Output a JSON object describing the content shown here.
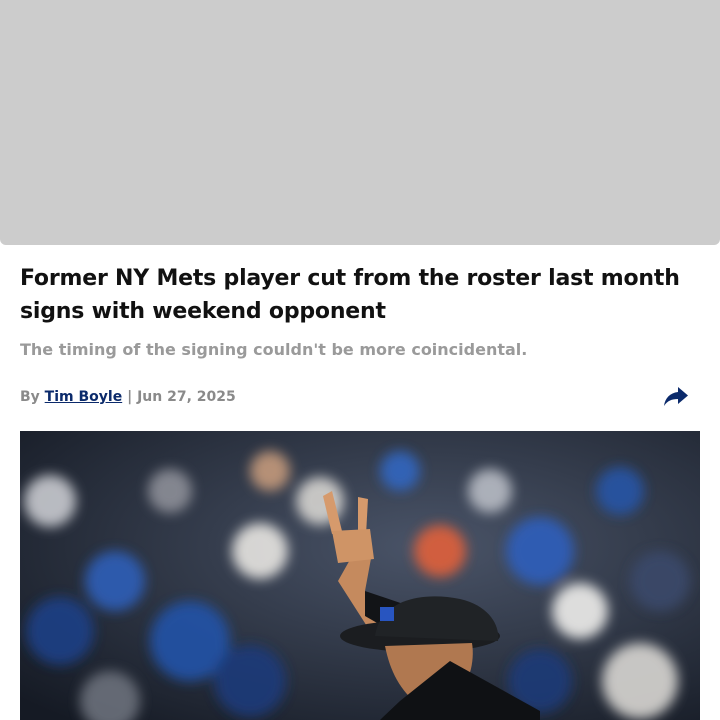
{
  "article": {
    "headline": "Former NY Mets player cut from the roster last month signs with weekend opponent",
    "subheadline": "The timing of the signing couldn't be more coincidental.",
    "byline": {
      "prefix": "By",
      "author": "Tim Boyle",
      "separator": "|",
      "date": "Jun 27, 2025"
    }
  },
  "icons": {
    "share": "share-arrow-icon"
  },
  "colors": {
    "ad_placeholder": "#cccccc",
    "headline": "#111111",
    "subheadline": "#9a9a9a",
    "author_link": "#0b2a6b",
    "share_icon": "#0b2a6b"
  }
}
